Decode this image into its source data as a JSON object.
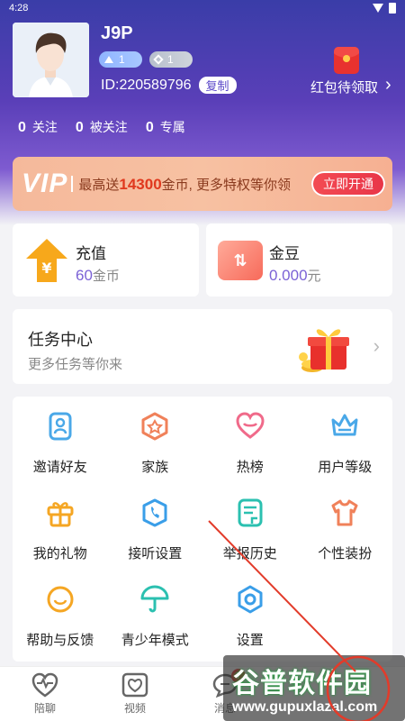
{
  "status_bar": {
    "time": "4:28"
  },
  "profile": {
    "username": "J9P",
    "badge_level_1": "1",
    "badge_level_2": "1",
    "id_text": "ID:220589796",
    "copy_label": "复制",
    "redpack_label": "红包待领取",
    "stats": [
      {
        "num": "0",
        "label": "关注"
      },
      {
        "num": "0",
        "label": "被关注"
      },
      {
        "num": "0",
        "label": "专属"
      }
    ]
  },
  "vip": {
    "logo": "VIP",
    "promo_prefix": "最高送",
    "promo_amount": "14300",
    "promo_suffix": "金币, 更多特权等你领",
    "button": "立即开通"
  },
  "wallet": {
    "recharge_title": "充值",
    "recharge_value": "60",
    "recharge_unit": "金币",
    "beans_title": "金豆",
    "beans_value": "0.000",
    "beans_unit": "元"
  },
  "task": {
    "title": "任务中心",
    "subtitle": "更多任务等你来"
  },
  "grid": [
    {
      "label": "邀请好友",
      "icon": "invite-icon",
      "color": "#4aa8e8"
    },
    {
      "label": "家族",
      "icon": "family-icon",
      "color": "#f0815a"
    },
    {
      "label": "热榜",
      "icon": "heart-icon",
      "color": "#f06a8a"
    },
    {
      "label": "用户等级",
      "icon": "crown-icon",
      "color": "#4aa8e8"
    },
    {
      "label": "我的礼物",
      "icon": "gift-icon",
      "color": "#f5a623"
    },
    {
      "label": "接听设置",
      "icon": "phone-icon",
      "color": "#3a9ee8"
    },
    {
      "label": "举报历史",
      "icon": "report-icon",
      "color": "#2bc0b0"
    },
    {
      "label": "个性装扮",
      "icon": "shirt-icon",
      "color": "#f0815a"
    },
    {
      "label": "帮助与反馈",
      "icon": "help-icon",
      "color": "#f5a623"
    },
    {
      "label": "青少年模式",
      "icon": "umbrella-icon",
      "color": "#2bc0b0"
    },
    {
      "label": "设置",
      "icon": "settings-icon",
      "color": "#3a9ee8"
    }
  ],
  "tabs": [
    {
      "label": "陪聊",
      "icon": "chat-heart-icon"
    },
    {
      "label": "视频",
      "icon": "video-heart-icon"
    },
    {
      "label": "消息",
      "icon": "message-icon",
      "badge": "7"
    }
  ],
  "watermark": {
    "title": "谷普软件园",
    "url": "www.gupuxlazal.com"
  }
}
